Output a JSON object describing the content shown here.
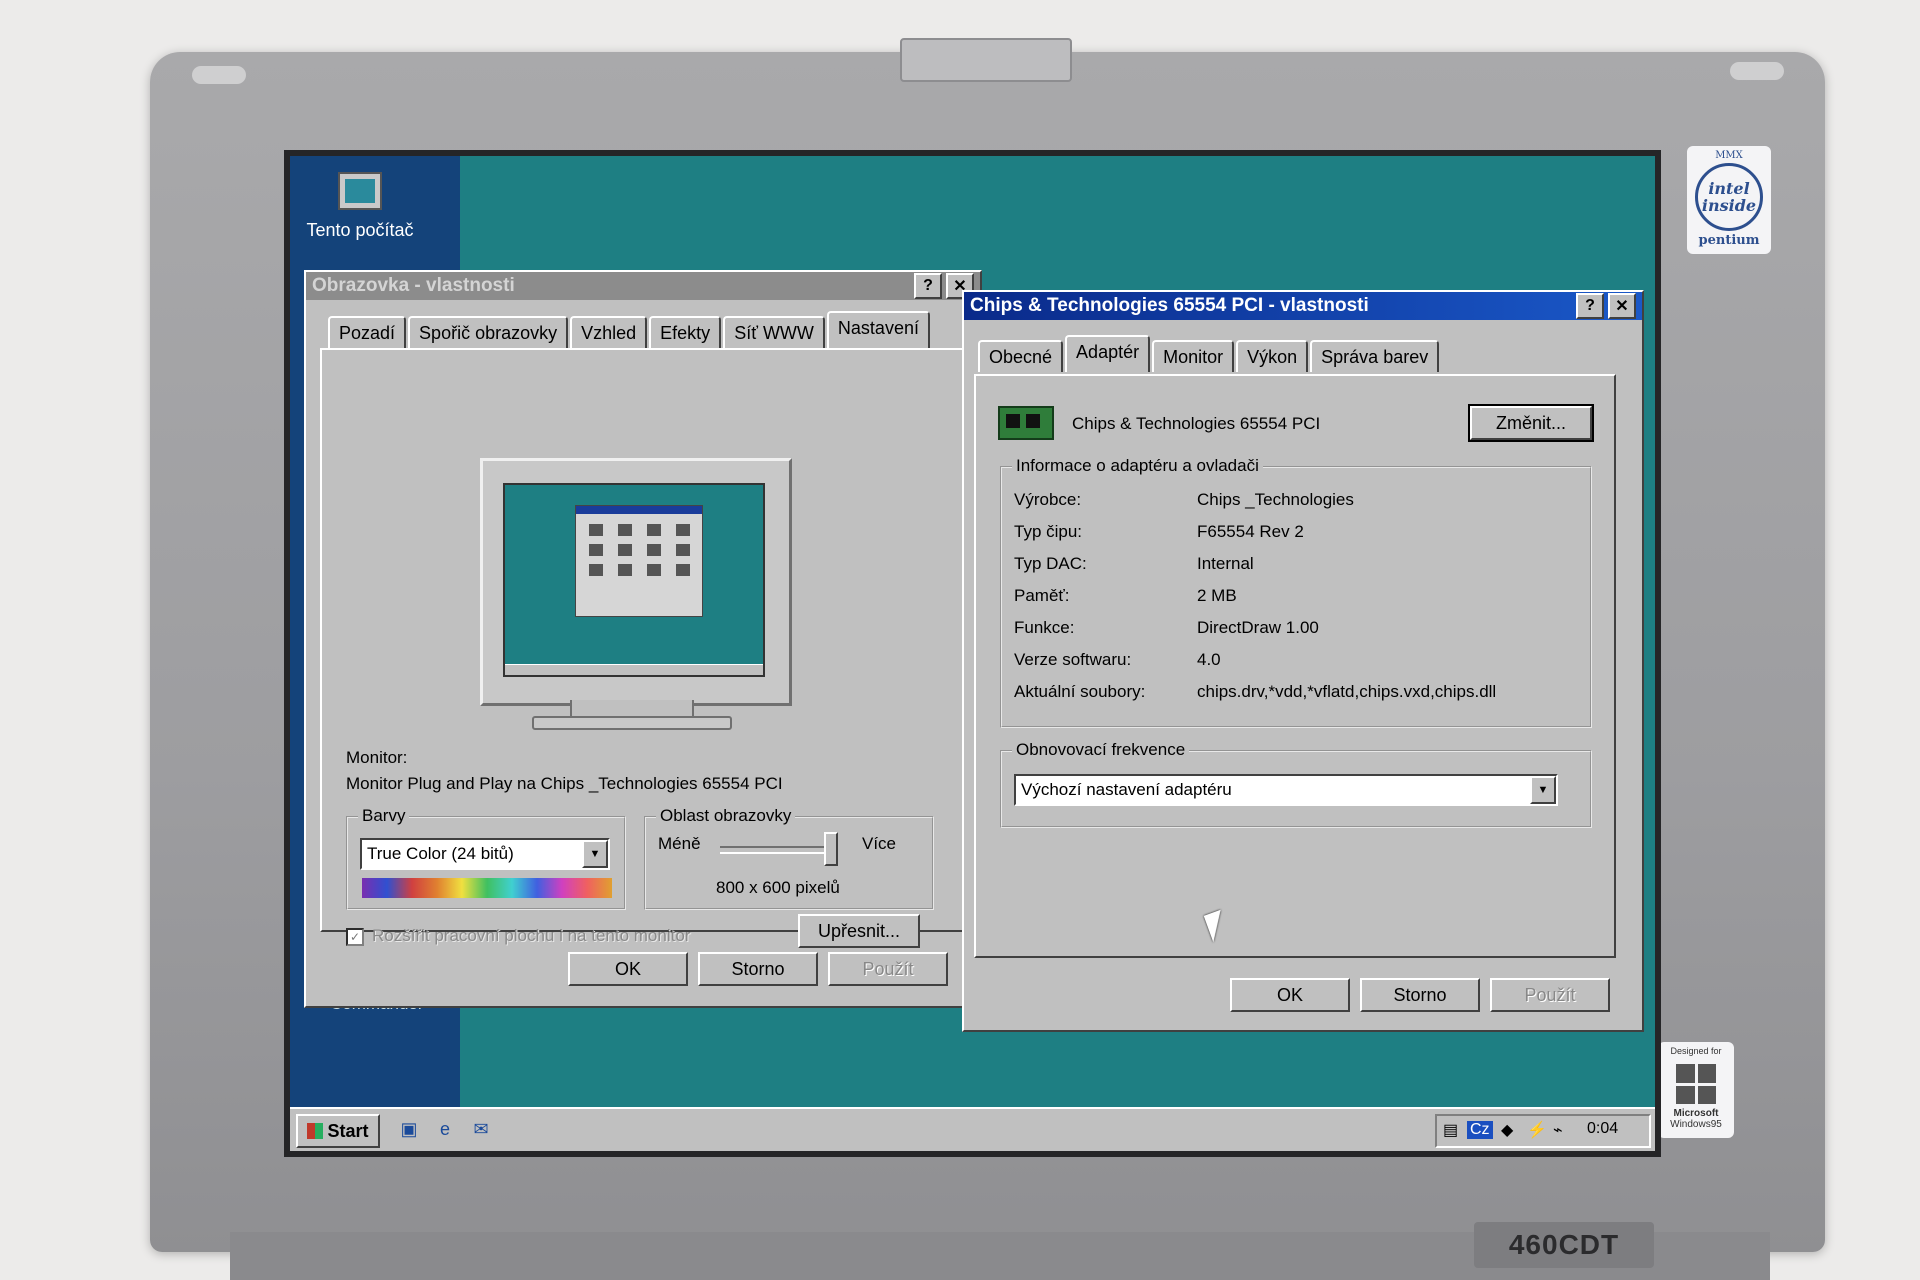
{
  "desktop": {
    "icon_label": "Tento počítač",
    "hidden_label": "Commander"
  },
  "display_props": {
    "title": "Obrazovka - vlastnosti",
    "help_btn": "?",
    "close_btn": "✕",
    "tabs": [
      "Pozadí",
      "Spořič obrazovky",
      "Vzhled",
      "Efekty",
      "Síť WWW",
      "Nastavení"
    ],
    "selected_tab": "Nastavení",
    "monitor_label": "Monitor:",
    "monitor_value": "Monitor Plug and Play na Chips _Technologies 65554 PCI",
    "colors_group": "Barvy",
    "colors_value": "True Color (24 bitů)",
    "area_group": "Oblast obrazovky",
    "area_less": "Méně",
    "area_more": "Více",
    "area_value": "800 x 600 pixelů",
    "extend_checkbox": "Rozšířit pracovní plochu i na tento monitor",
    "advanced_btn": "Upřesnit...",
    "ok": "OK",
    "cancel": "Storno",
    "apply": "Použít"
  },
  "adapter_props": {
    "title": "Chips & Technologies 65554 PCI - vlastnosti",
    "help_btn": "?",
    "close_btn": "✕",
    "tabs": [
      "Obecné",
      "Adaptér",
      "Monitor",
      "Výkon",
      "Správa barev"
    ],
    "selected_tab": "Adaptér",
    "adapter_name": "Chips & Technologies 65554 PCI",
    "change_btn": "Změnit...",
    "info_group": "Informace o adaptéru a ovladači",
    "info_rows": [
      {
        "label": "Výrobce:",
        "value": "Chips _Technologies"
      },
      {
        "label": "Typ čipu:",
        "value": "F65554 Rev 2"
      },
      {
        "label": "Typ DAC:",
        "value": "Internal"
      },
      {
        "label": "Paměť:",
        "value": "2 MB"
      },
      {
        "label": "Funkce:",
        "value": "DirectDraw 1.00"
      },
      {
        "label": "Verze softwaru:",
        "value": "4.0"
      },
      {
        "label": "Aktuální soubory:",
        "value": "chips.drv,*vdd,*vflatd,chips.vxd,chips.dll"
      }
    ],
    "refresh_group": "Obnovovací frekvence",
    "refresh_value": "Výchozí nastavení adaptéru",
    "ok": "OK",
    "cancel": "Storno",
    "apply": "Použít"
  },
  "taskbar": {
    "start": "Start",
    "lang": "Cz",
    "clock": "0:04"
  },
  "hardware": {
    "intel_top": "MMX",
    "intel_ring": "intel inside",
    "intel_brand": "pentium",
    "ms_top": "Designed for",
    "ms_brand": "Microsoft",
    "ms_os": "Windows95",
    "model": "460CDT"
  }
}
